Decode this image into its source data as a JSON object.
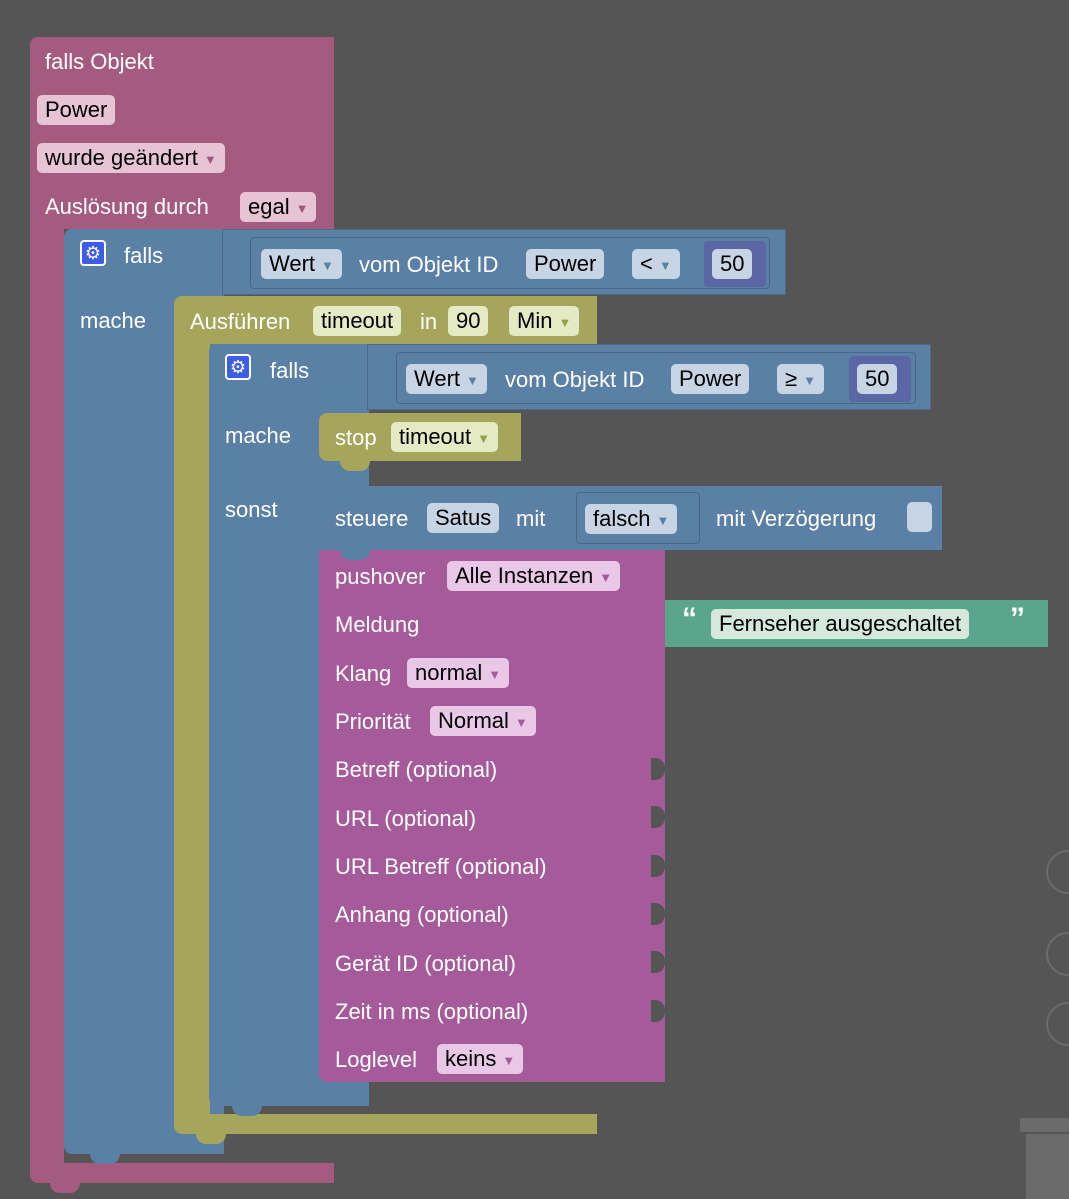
{
  "trigger": {
    "title": "falls Objekt",
    "object": "Power",
    "event": "wurde geändert",
    "trigger_label": "Auslösung durch",
    "trigger_value": "egal"
  },
  "if_outer": {
    "falls": "falls",
    "mache": "mache",
    "condition": {
      "value_field": "Wert",
      "of_object": "vom Objekt ID",
      "object": "Power",
      "operator": "<",
      "number": "50"
    }
  },
  "timeout": {
    "label": "Ausführen",
    "name": "timeout",
    "in": "in",
    "value": "90",
    "unit": "Min"
  },
  "if_inner": {
    "falls": "falls",
    "mache": "mache",
    "sonst": "sonst",
    "condition": {
      "value_field": "Wert",
      "of_object": "vom Objekt ID",
      "object": "Power",
      "operator": "≥",
      "number": "50"
    }
  },
  "stop": {
    "label": "stop",
    "name": "timeout"
  },
  "control": {
    "label": "steuere",
    "object": "Satus",
    "with": "mit",
    "value": "falsch",
    "delay_label": "mit Verzögerung"
  },
  "pushover": {
    "label": "pushover",
    "instance": "Alle Instanzen",
    "message_label": "Meldung",
    "message_open_quote": "“",
    "message_value": "Fernseher ausgeschaltet",
    "message_close_quote": "”",
    "sound_label": "Klang",
    "sound_value": "normal",
    "priority_label": "Priorität",
    "priority_value": "Normal",
    "subject_label": "Betreff (optional)",
    "url_label": "URL (optional)",
    "url_title_label": "URL Betreff (optional)",
    "attachment_label": "Anhang (optional)",
    "device_label": "Gerät ID (optional)",
    "time_label": "Zeit in ms (optional)",
    "loglevel_label": "Loglevel",
    "loglevel_value": "keins"
  },
  "colors": {
    "trigger": "#a55b80",
    "logic": "#5b80a5",
    "timeout": "#a5a55b",
    "pushover": "#a55b9a",
    "text": "#5ba58c",
    "number": "#5b67a5",
    "background": "#555555"
  },
  "icons": {
    "gear": "gear-icon",
    "trash": "trash-icon",
    "zoom": "zoom-icon"
  }
}
